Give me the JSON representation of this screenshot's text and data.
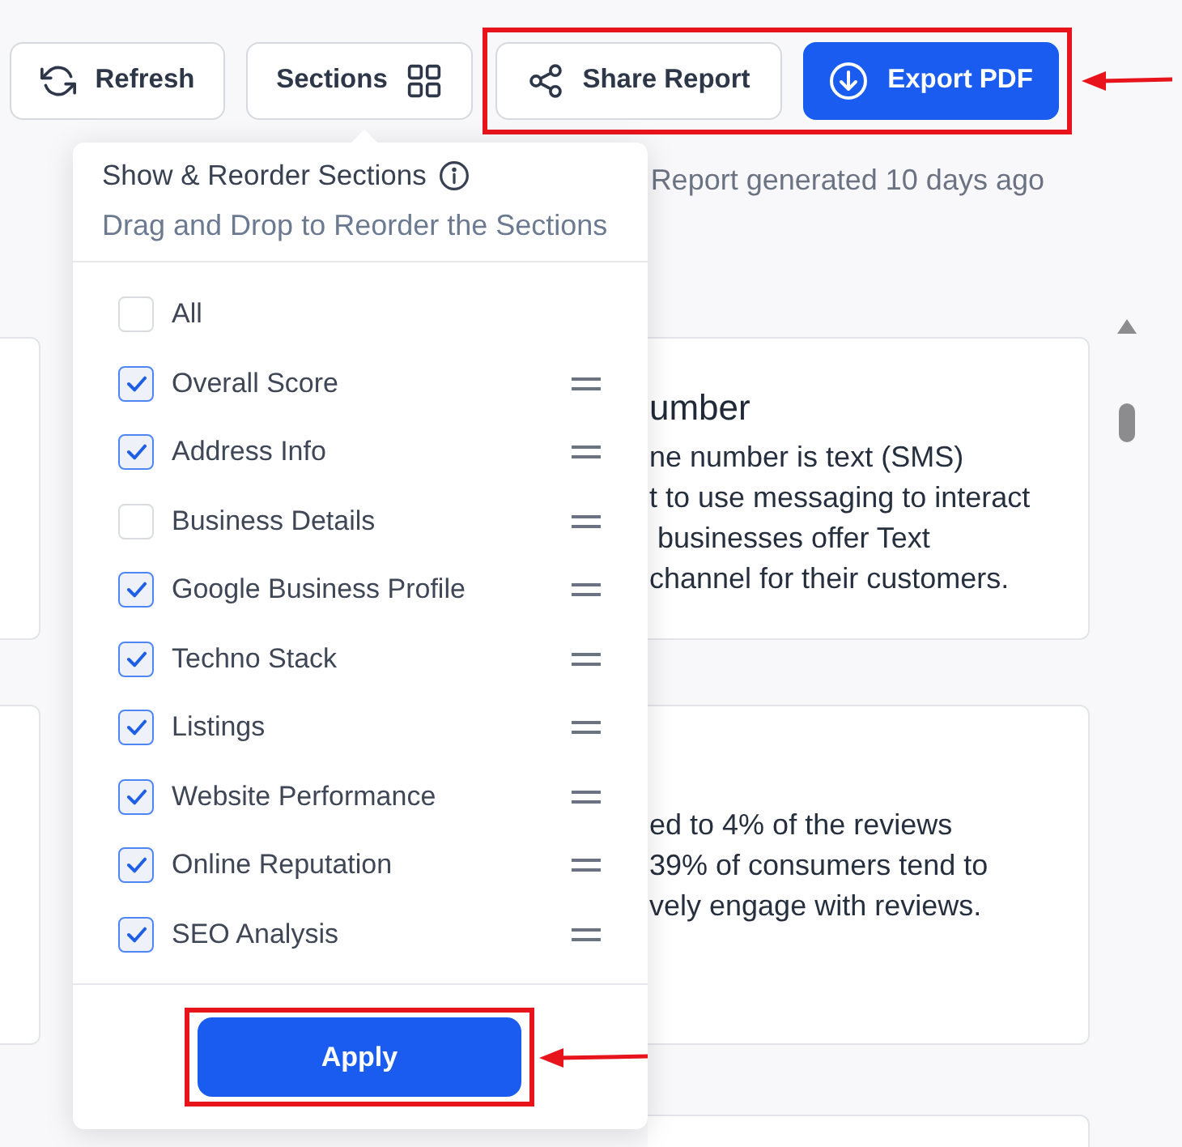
{
  "toolbar": {
    "buttons": [
      {
        "kind": "refresh",
        "label": "Refresh"
      },
      {
        "kind": "sections",
        "label": "Sections"
      }
    ],
    "share_group": {
      "highlighted": true,
      "buttons": [
        {
          "kind": "share",
          "label": "Share Report"
        },
        {
          "kind": "export",
          "label": "Export PDF"
        }
      ]
    }
  },
  "report_status": "Report generated 10 days ago",
  "cards": [
    {
      "heading": "umber",
      "lines": [
        "ne number is text (SMS)",
        "t to use messaging to interact",
        " businesses offer Text",
        "channel for their customers."
      ]
    },
    {
      "lines": [
        "ed to 4% of the reviews",
        "39% of consumers tend to",
        "vely engage with reviews."
      ]
    }
  ],
  "sections_popup": {
    "title": "Show & Reorder Sections",
    "subtitle": "Drag and Drop to Reorder the Sections",
    "items": [
      {
        "label": "All",
        "checked": false,
        "draggable": false
      },
      {
        "label": "Overall Score",
        "checked": true,
        "draggable": true
      },
      {
        "label": "Address Info",
        "checked": true,
        "draggable": true
      },
      {
        "label": "Business Details",
        "checked": false,
        "draggable": true
      },
      {
        "label": "Google Business Profile",
        "checked": true,
        "draggable": true
      },
      {
        "label": "Techno Stack",
        "checked": true,
        "draggable": true
      },
      {
        "label": "Listings",
        "checked": true,
        "draggable": true
      },
      {
        "label": "Website Performance",
        "checked": true,
        "draggable": true
      },
      {
        "label": "Online Reputation",
        "checked": true,
        "draggable": true
      },
      {
        "label": "SEO Analysis",
        "checked": true,
        "draggable": true
      }
    ],
    "apply_button": {
      "label": "Apply",
      "highlighted": true
    }
  }
}
